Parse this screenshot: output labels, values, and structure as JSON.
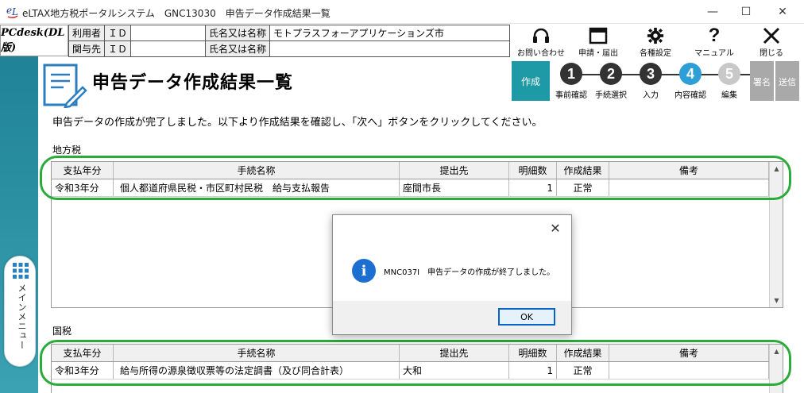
{
  "window": {
    "title": "eLTAX地方税ポータルシステム　GNC13030　申告データ作成結果一覧",
    "minimize": "—",
    "maximize": "☐",
    "close": "✕"
  },
  "header": {
    "pcdesk": "PCdesk(DL版)",
    "user_label": "利用者",
    "partner_label": "関与先",
    "id_label": "ＩＤ",
    "name_label": "氏名又は名称",
    "user_name": "モトプラスフォーアプリケーションズ市",
    "partner_name": ""
  },
  "toolbar": [
    {
      "label": "お問い合わせ",
      "icon": "headset-icon"
    },
    {
      "label": "申請・届出",
      "icon": "window-icon"
    },
    {
      "label": "各種設定",
      "icon": "gear-icon"
    },
    {
      "label": "マニュアル",
      "icon": "question-icon"
    },
    {
      "label": "閉じる",
      "icon": "close-icon"
    }
  ],
  "screen": {
    "title": "申告データ作成結果一覧",
    "instruction": "申告データの作成が完了しました。以下より作成結果を確認し、「次へ」ボタンをクリックしてください。"
  },
  "steps": {
    "current_phase": "作成",
    "items": [
      {
        "num": "1",
        "label": "事前確認",
        "color": "#333333"
      },
      {
        "num": "2",
        "label": "手続選択",
        "color": "#333333"
      },
      {
        "num": "3",
        "label": "入力",
        "color": "#333333"
      },
      {
        "num": "4",
        "label": "内容確認",
        "color": "#2e9fd6"
      },
      {
        "num": "5",
        "label": "編集",
        "color": "#c8c8c8"
      }
    ],
    "sign": "署名",
    "send": "送信"
  },
  "columns": [
    "支払年分",
    "手続名称",
    "提出先",
    "明細数",
    "作成結果",
    "備考"
  ],
  "local_tax": {
    "label": "地方税",
    "rows": [
      {
        "year": "令和3年分",
        "procedure": "個人都道府県民税・市区町村民税　給与支払報告",
        "destination": "座間市長",
        "count": "1",
        "result": "正常",
        "note": ""
      }
    ]
  },
  "national_tax": {
    "label": "国税",
    "rows": [
      {
        "year": "令和3年分",
        "procedure": "給与所得の源泉徴収票等の法定調書（及び同合計表）",
        "destination": "大和",
        "count": "1",
        "result": "正常",
        "note": ""
      }
    ]
  },
  "side_menu": {
    "label": "メインメニュー"
  },
  "dialog": {
    "message": "MNC037I　申告データの作成が終了しました。",
    "ok": "OK",
    "close": "✕"
  },
  "colors": {
    "accent": "#1e9aa6",
    "highlight": "#2bab3a",
    "info": "#1c6fd1"
  }
}
